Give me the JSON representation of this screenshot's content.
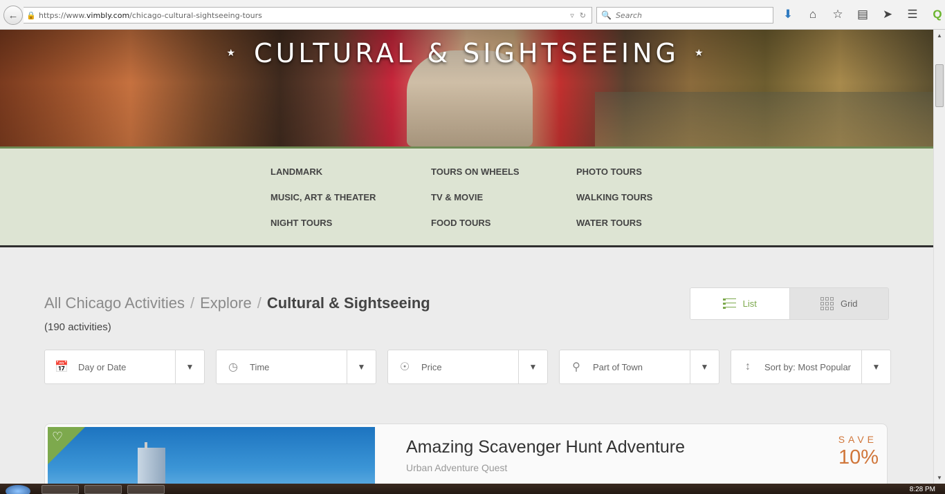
{
  "browser": {
    "url_prefix": "https://www.",
    "url_domain": "vimbly.com",
    "url_path": "/chicago-cultural-sightseeing-tours",
    "search_placeholder": "Search"
  },
  "hero": {
    "title": "CULTURAL & SIGHTSEEING",
    "star": "★"
  },
  "categories": [
    "LANDMARK",
    "TOURS ON WHEELS",
    "PHOTO TOURS",
    "MUSIC, ART & THEATER",
    "TV & MOVIE",
    "WALKING TOURS",
    "NIGHT TOURS",
    "FOOD TOURS",
    "WATER TOURS"
  ],
  "breadcrumb": {
    "items": [
      "All Chicago Activities",
      "Explore"
    ],
    "separator": "/",
    "current": "Cultural & Sightseeing"
  },
  "activity_count": "(190 activities)",
  "view_toggle": {
    "list_label": "List",
    "grid_label": "Grid",
    "active": "list",
    "accent_color": "#7da94d"
  },
  "filters": [
    {
      "label": "Day or Date",
      "icon": "calendar-icon"
    },
    {
      "label": "Time",
      "icon": "clock-icon"
    },
    {
      "label": "Price",
      "icon": "coins-icon"
    },
    {
      "label": "Part of Town",
      "icon": "location-pin-icon"
    },
    {
      "label": "Sort by: Most Popular",
      "icon": "sort-icon"
    }
  ],
  "listing": {
    "title": "Amazing Scavenger Hunt Adventure",
    "subtitle": "Urban Adventure Quest",
    "save_label": "SAVE",
    "save_value": "10%",
    "save_color": "#d0763a"
  },
  "taskbar": {
    "clock": "8:28 PM"
  }
}
